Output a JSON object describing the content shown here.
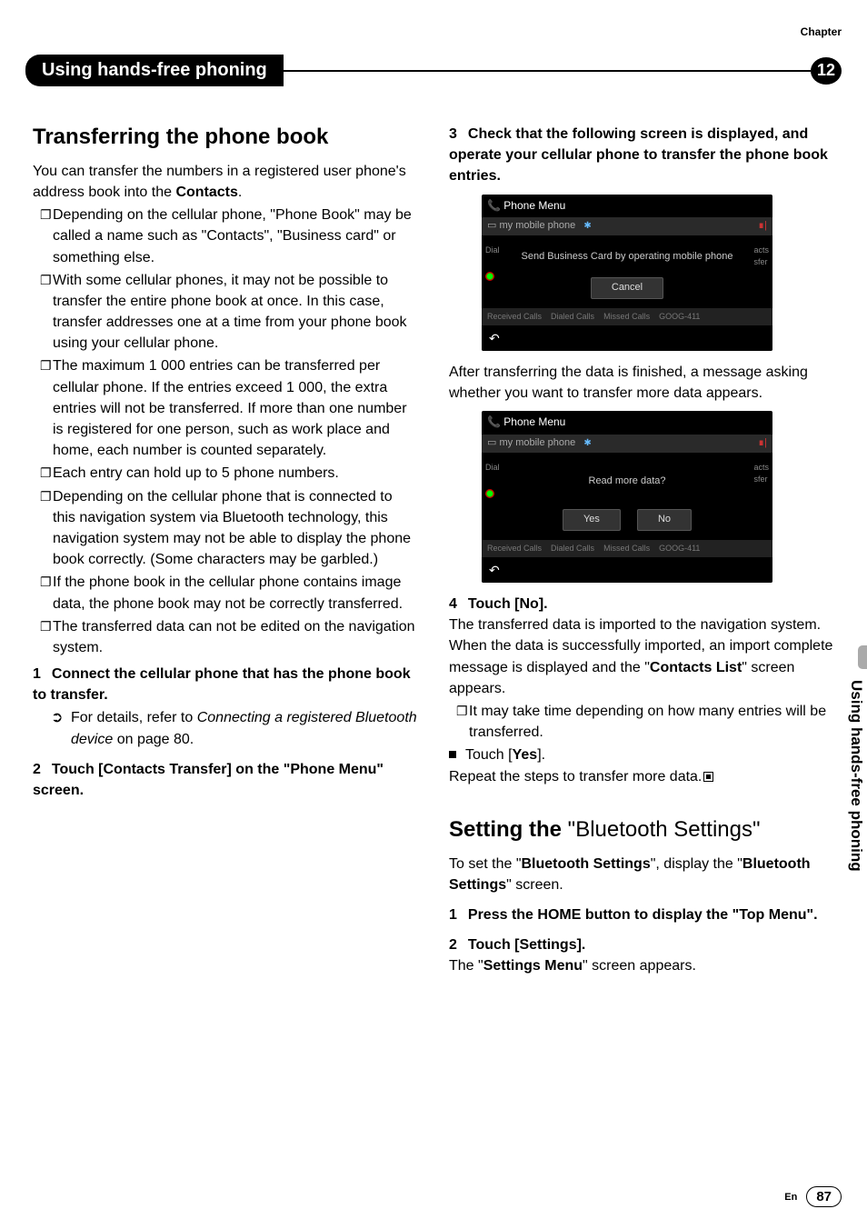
{
  "header": {
    "chapter_label": "Chapter",
    "chapter_number": "12",
    "chapter_title": "Using hands-free phoning"
  },
  "side_tab": "Using hands-free phoning",
  "footer": {
    "lang": "En",
    "page": "87"
  },
  "left": {
    "h2": "Transferring the phone book",
    "intro_a": "You can transfer the numbers in a registered user phone's address book into the ",
    "intro_b": "Contacts",
    "intro_c": ".",
    "bullets": [
      "Depending on the cellular phone, \"Phone Book\" may be called a name such as \"Contacts\", \"Business card\" or something else.",
      "With some cellular phones, it may not be possible to transfer the entire phone book at once. In this case, transfer addresses one at a time from your phone book using your cellular phone.",
      "The maximum 1 000 entries can be transferred per cellular phone. If the entries exceed 1 000, the extra entries will not be transferred. If more than one number is registered for one person, such as work place and home, each number is counted separately.",
      "Each entry can hold up to 5 phone numbers.",
      "Depending on the cellular phone that is connected to this navigation system via Bluetooth technology, this navigation system may not be able to display the phone book correctly. (Some characters may be garbled.)",
      "If the phone book in the cellular phone contains image data, the phone book may not be correctly transferred.",
      "The transferred data can not be edited on the navigation system."
    ],
    "step1_num": "1",
    "step1": "Connect the cellular phone that has the phone book to transfer.",
    "step1_sub_a": "For details, refer to ",
    "step1_sub_i": "Connecting a registered Bluetooth device",
    "step1_sub_b": " on page 80.",
    "step2_num": "2",
    "step2": "Touch [Contacts Transfer] on the \"Phone Menu\" screen."
  },
  "right": {
    "step3_num": "3",
    "step3": "Check that the following screen is displayed, and operate your cellular phone to transfer the phone book entries.",
    "ss1": {
      "title": "Phone Menu",
      "device": "my mobile phone",
      "dial": "Dial",
      "side_right_a": "acts",
      "side_right_b": "sfer",
      "msg": "Send Business Card by operating mobile phone",
      "cancel": "Cancel",
      "tab1": "Received Calls",
      "tab2": "Dialed Calls",
      "tab3": "Missed Calls",
      "tab4": "GOOG-411",
      "back": "↶"
    },
    "after_ss1": "After transferring the data is finished, a message asking whether you want to transfer more data appears.",
    "ss2": {
      "title": "Phone Menu",
      "device": "my mobile phone",
      "dial": "Dial",
      "side_right_a": "acts",
      "side_right_b": "sfer",
      "msg": "Read more data?",
      "yes": "Yes",
      "no": "No",
      "tab1": "Received Calls",
      "tab2": "Dialed Calls",
      "tab3": "Missed Calls",
      "tab4": "GOOG-411",
      "back": "↶"
    },
    "step4_num": "4",
    "step4": "Touch [No].",
    "step4_p1": "The transferred data is imported to the navigation system.",
    "step4_p2a": "When the data is successfully imported, an import complete message is displayed and the \"",
    "step4_p2b": "Contacts List",
    "step4_p2c": "\" screen appears.",
    "step4_bullet": "It may take time depending on how many entries will be transferred.",
    "touch_yes_a": "Touch [",
    "touch_yes_b": "Yes",
    "touch_yes_c": "].",
    "touch_yes_p": "Repeat the steps to transfer more data.",
    "h2_a": "Setting the ",
    "h2_b": "\"Bluetooth Settings\"",
    "bt_p_a": "To set the \"",
    "bt_p_b": "Bluetooth Settings",
    "bt_p_c": "\", display the \"",
    "bt_p_d": "Bluetooth Settings",
    "bt_p_e": "\" screen.",
    "bt_step1_num": "1",
    "bt_step1": "Press the HOME button to display the \"Top Menu\".",
    "bt_step2_num": "2",
    "bt_step2": "Touch [Settings].",
    "bt_step2_pa": "The \"",
    "bt_step2_pb": "Settings Menu",
    "bt_step2_pc": "\" screen appears."
  }
}
